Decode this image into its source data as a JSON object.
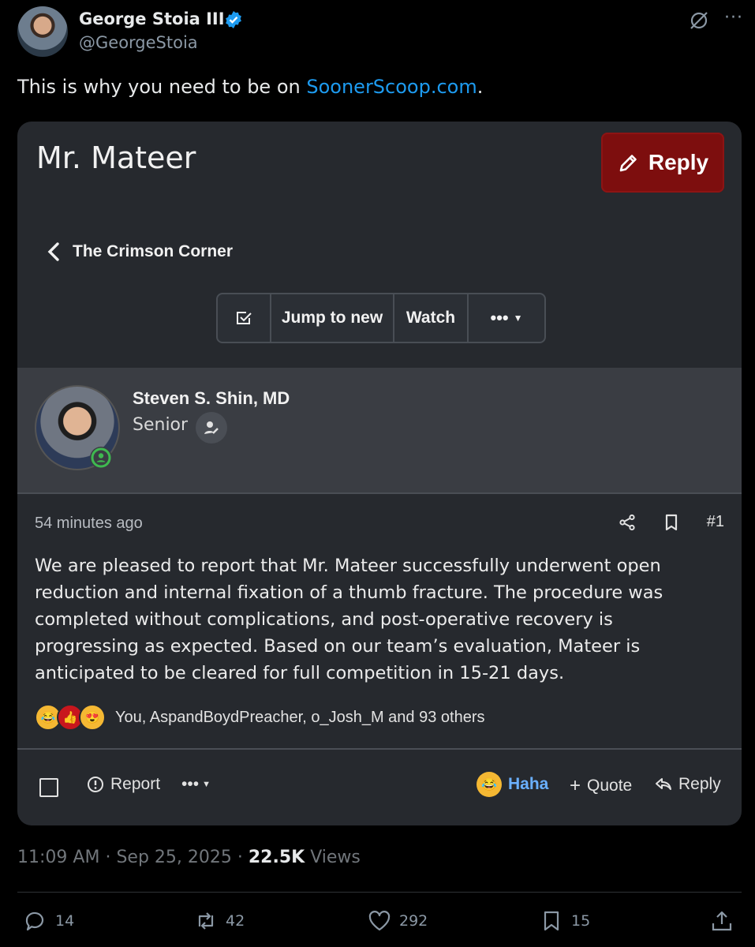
{
  "tweet": {
    "display_name": "George Stoia III",
    "handle": "@GeorgeStoia",
    "text_prefix": "This is why you need to be on ",
    "link_text": "SoonerScoop.com",
    "text_suffix": ".",
    "time": "11:09 AM",
    "date": "Sep 25, 2025",
    "views_count": "22.5K",
    "views_label": "Views",
    "sep": "·"
  },
  "card": {
    "thread_title": "Mr. Mateer",
    "reply_button": "Reply",
    "breadcrumb": "The Crimson Corner",
    "toolbar": {
      "jump": "Jump to new",
      "watch": "Watch",
      "more": "•••"
    },
    "author": {
      "name": "Steven S. Shin, MD",
      "title": "Senior"
    },
    "post": {
      "time": "54 minutes ago",
      "number": "#1",
      "body": "We are pleased to report that Mr. Mateer successfully underwent open reduction and internal fixation of a thumb fracture. The procedure was completed without complications, and post-operative recovery is progressing as expected. Based on our team’s evaluation, Mateer is anticipated to be cleared for full competition in 15-21 days.",
      "reactions_text": "You, AspandBoydPreacher, o_Josh_M and 93 others"
    },
    "footer": {
      "report": "Report",
      "more": "•••",
      "haha": "Haha",
      "quote": "Quote",
      "reply": "Reply"
    }
  },
  "engagement": {
    "replies": "14",
    "reposts": "42",
    "likes": "292",
    "bookmarks": "15"
  },
  "colors": {
    "background": "#000000",
    "card": "#26292e",
    "reply_button": "#7d0e0e",
    "link": "#1d9bf0",
    "haha": "#6ab0ff"
  }
}
